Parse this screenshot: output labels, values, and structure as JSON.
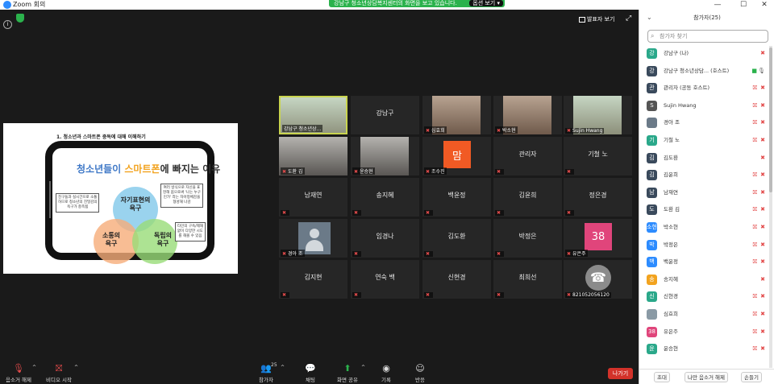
{
  "window": {
    "title": "Zoom 회의",
    "minimize": "—",
    "maximize": "☐",
    "close": "✕"
  },
  "banner": {
    "text": "강남구 청소년상담복지센터의 화면을 보고 있습니다.",
    "view_options": "옵션 보기 ▾"
  },
  "top_controls": {
    "speaker_view": "발표자 보기",
    "fullscreen": "⤢"
  },
  "slide": {
    "heading": "1. 청소년과 스마트폰 중독에 대해 이해하기",
    "title_part1": "청소년들이",
    "title_part2": "스마트폰",
    "title_part3": "에 빠지는 이유",
    "circle_top": "자기표현의\n욕구",
    "circle_left": "소통의\n욕구",
    "circle_right": "독립의\n욕구",
    "callout_left": "친구들과 실시간으로 소통\n하므로 청소년의 친밀감의\n욕구가 충족됨",
    "callout_right": "여러 방식으로 자신을 표\n현해 봄으로써 '나는 누구\n인가' 라는 자아정체감을\n형성해 나감",
    "callout_bottom": "타인의 구속/제재\n없이 다양한 시도\n를 해볼 수 있음"
  },
  "gallery": [
    {
      "name": "",
      "label": "강남구 청소년상...",
      "muted": false,
      "video": "cool",
      "active": true
    },
    {
      "name": "강남구",
      "label": "",
      "muted": false,
      "video": "none",
      "active": false
    },
    {
      "name": "",
      "label": "심효희",
      "muted": true,
      "video": "warm",
      "active": false
    },
    {
      "name": "",
      "label": "박소현",
      "muted": true,
      "video": "warm",
      "active": false
    },
    {
      "name": "",
      "label": "Sujin Hwang",
      "muted": true,
      "video": "cool",
      "active": false
    },
    {
      "name": "",
      "label": "도환 김",
      "muted": true,
      "video": "dark",
      "active": false
    },
    {
      "name": "",
      "label": "윤승현",
      "muted": true,
      "video": "dark",
      "active": false
    },
    {
      "name": "",
      "label": "조수진",
      "muted": true,
      "video": "avatar",
      "avatar": "맘",
      "avatar_color": "#f15a24",
      "active": false
    },
    {
      "name": "관리자",
      "label": "",
      "muted": true,
      "video": "none",
      "active": false
    },
    {
      "name": "기철 노",
      "label": "",
      "muted": true,
      "video": "none",
      "active": false
    },
    {
      "name": "남재연",
      "label": "",
      "muted": true,
      "video": "none",
      "active": false
    },
    {
      "name": "송지혜",
      "label": "",
      "muted": true,
      "video": "none",
      "active": false
    },
    {
      "name": "백윤정",
      "label": "",
      "muted": true,
      "video": "none",
      "active": false
    },
    {
      "name": "김윤희",
      "label": "",
      "muted": true,
      "video": "none",
      "active": false
    },
    {
      "name": "정은경",
      "label": "",
      "muted": true,
      "video": "none",
      "active": false
    },
    {
      "name": "",
      "label": "경아 조",
      "muted": true,
      "video": "person",
      "active": false
    },
    {
      "name": "임경나",
      "label": "",
      "muted": true,
      "video": "none",
      "active": false
    },
    {
      "name": "김도환",
      "label": "",
      "muted": true,
      "video": "none",
      "active": false
    },
    {
      "name": "박정은",
      "label": "",
      "muted": true,
      "video": "none",
      "active": false
    },
    {
      "name": "",
      "label": "유은주",
      "muted": true,
      "video": "avatar",
      "avatar": "38",
      "avatar_color": "#e0457b",
      "active": false
    },
    {
      "name": "김지현",
      "label": "",
      "muted": true,
      "video": "none",
      "active": false
    },
    {
      "name": "연숙 백",
      "label": "",
      "muted": true,
      "video": "none",
      "active": false
    },
    {
      "name": "신현경",
      "label": "",
      "muted": true,
      "video": "none",
      "active": false
    },
    {
      "name": "최희선",
      "label": "",
      "muted": true,
      "video": "none",
      "active": false
    },
    {
      "name": "",
      "label": "821052056120",
      "muted": true,
      "video": "phone",
      "active": false
    }
  ],
  "toolbar": {
    "unmute": "음소거 해제",
    "start_video": "비디오 시작",
    "participants": "참가자",
    "participants_count": "25",
    "chat": "채팅",
    "share_screen": "화면 공유",
    "record": "기록",
    "reactions": "반응",
    "leave": "나가기"
  },
  "panel": {
    "title": "참가자(25)",
    "search_placeholder": "참가자 찾기",
    "participants": [
      {
        "initial": "강",
        "color": "#2aa88a",
        "name": "강남구 (나)",
        "cam": "",
        "mic": "mute"
      },
      {
        "initial": "강",
        "color": "#3a4a5c",
        "name": "강남구 청소년상담... (호스트)",
        "cam": "video-on",
        "mic": "on"
      },
      {
        "initial": "관",
        "color": "#3a4a5c",
        "name": "관리자 (공동 호스트)",
        "cam": "off",
        "mic": "mute"
      },
      {
        "initial": "S",
        "color": "#555555",
        "name": "Sujin Hwang",
        "cam": "off",
        "mic": "mute"
      },
      {
        "initial": "",
        "color": "#6b7a88",
        "name": "경아 조",
        "cam": "off",
        "mic": "mute"
      },
      {
        "initial": "기",
        "color": "#2aa88a",
        "name": "기철 노",
        "cam": "off",
        "mic": "mute"
      },
      {
        "initial": "김",
        "color": "#3a4a5c",
        "name": "김도환",
        "cam": "",
        "mic": "mute"
      },
      {
        "initial": "김",
        "color": "#3a4a5c",
        "name": "김윤희",
        "cam": "off",
        "mic": "mute"
      },
      {
        "initial": "남",
        "color": "#3a4a5c",
        "name": "남재연",
        "cam": "off",
        "mic": "mute"
      },
      {
        "initial": "도",
        "color": "#3a4a5c",
        "name": "도환 김",
        "cam": "off",
        "mic": "mute"
      },
      {
        "initial": "소현",
        "color": "#2d8cff",
        "name": "박소현",
        "cam": "off",
        "mic": "mute"
      },
      {
        "initial": "박",
        "color": "#2d8cff",
        "name": "박정은",
        "cam": "off",
        "mic": "mute"
      },
      {
        "initial": "백",
        "color": "#2d8cff",
        "name": "백윤정",
        "cam": "off",
        "mic": "mute"
      },
      {
        "initial": "송",
        "color": "#f2a31f",
        "name": "송지혜",
        "cam": "",
        "mic": "mute"
      },
      {
        "initial": "신",
        "color": "#2aa88a",
        "name": "신현경",
        "cam": "off",
        "mic": "mute"
      },
      {
        "initial": "",
        "color": "#8a9aa5",
        "name": "심효희",
        "cam": "off",
        "mic": "mute"
      },
      {
        "initial": "38",
        "color": "#e0457b",
        "name": "유은주",
        "cam": "off",
        "mic": "mute"
      },
      {
        "initial": "윤",
        "color": "#2aa88a",
        "name": "윤승현",
        "cam": "off",
        "mic": "mute"
      }
    ],
    "footer": {
      "invite": "초대",
      "mute_me": "나만 음소거 해제",
      "more": "손들기"
    }
  }
}
